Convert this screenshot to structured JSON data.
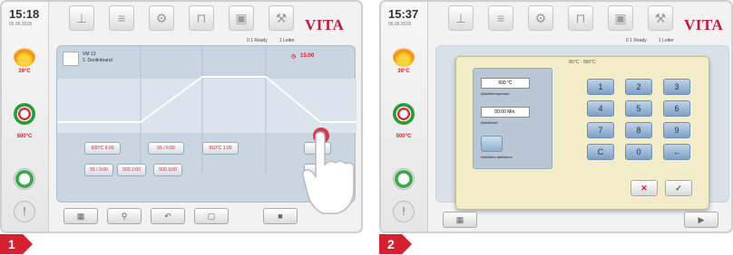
{
  "screens": [
    {
      "time": "15:18",
      "date": "06.06.2018",
      "temp1": "39°C",
      "temp2": "500°C",
      "brand": "VITA",
      "status1": "0 1 Ready",
      "status2": "1 Leiter",
      "program_line1": "VM 13",
      "program_line2": "1. Dentinbrand",
      "readout": "15:00",
      "chips_row1": [
        "600°C 6:00",
        "55 / 6:00",
        "910°C 1:00"
      ],
      "chips_row2": [
        "55 / 3:00",
        "500 2:00",
        "500 3:00"
      ],
      "badge": "1"
    },
    {
      "time": "15:37",
      "date": "06.06.2018",
      "temp1": "39°C",
      "temp2": "500°C",
      "brand": "VITA",
      "status1": "0 1 Ready",
      "status2": "1 Leiter",
      "dialog_title": "80°C - 950°C",
      "field1_value": "600 °C",
      "field1_label": "Abkühltemperatur",
      "field2_value": "00:00 Min.",
      "field2_label": "Abkühlzeit",
      "toggle_label": "Abkühlen aktivieren",
      "keys": [
        "1",
        "2",
        "3",
        "4",
        "5",
        "6",
        "7",
        "8",
        "9",
        "C",
        "0",
        "←"
      ],
      "cancel": "✕",
      "ok": "✓",
      "badge": "2"
    }
  ]
}
